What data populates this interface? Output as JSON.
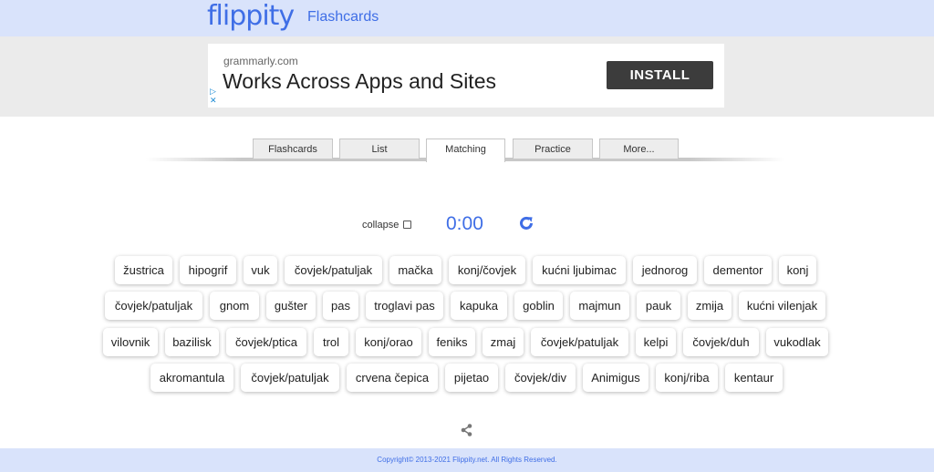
{
  "header": {
    "logo": "flippity",
    "app_name": "Flashcards"
  },
  "ad": {
    "domain": "grammarly.com",
    "headline": "Works Across Apps and Sites",
    "button": "INSTALL",
    "info_glyph": "▷",
    "close_glyph": "✕"
  },
  "tabs": [
    {
      "label": "Flashcards",
      "active": false
    },
    {
      "label": "List",
      "active": false
    },
    {
      "label": "Matching",
      "active": true
    },
    {
      "label": "Practice",
      "active": false
    },
    {
      "label": "More...",
      "active": false
    }
  ],
  "controls": {
    "collapse_label": "collapse",
    "collapse_checked": false,
    "timer": "0:00"
  },
  "cards": [
    [
      "žustrica",
      "hipogrif",
      "vuk",
      "čovjek/patuljak",
      "mačka",
      "konj/čovjek",
      "kućni ljubimac",
      "jednorog",
      "dementor",
      "konj"
    ],
    [
      "čovjek/patuljak",
      "gnom",
      "gušter",
      "pas",
      "troglavi pas",
      "kapuka",
      "goblin",
      "majmun",
      "pauk",
      "zmija",
      "kućni vilenjak"
    ],
    [
      "vilovnik",
      "bazilisk",
      "čovjek/ptica",
      "trol",
      "konj/orao",
      "feniks",
      "zmaj",
      "čovjek/patuljak",
      "kelpi",
      "čovjek/duh",
      "vukodlak"
    ],
    [
      "akromantula",
      "čovjek/patuljak",
      "crvena čepica",
      "pijetao",
      "čovjek/div",
      "Animigus",
      "konj/riba",
      "kentaur"
    ]
  ],
  "footer": {
    "copyright": "Copyright© 2013-2021 Flippity.net. All Rights Reserved."
  },
  "colors": {
    "accent": "#3f6ee6",
    "header_bg": "#d9e3fb"
  }
}
